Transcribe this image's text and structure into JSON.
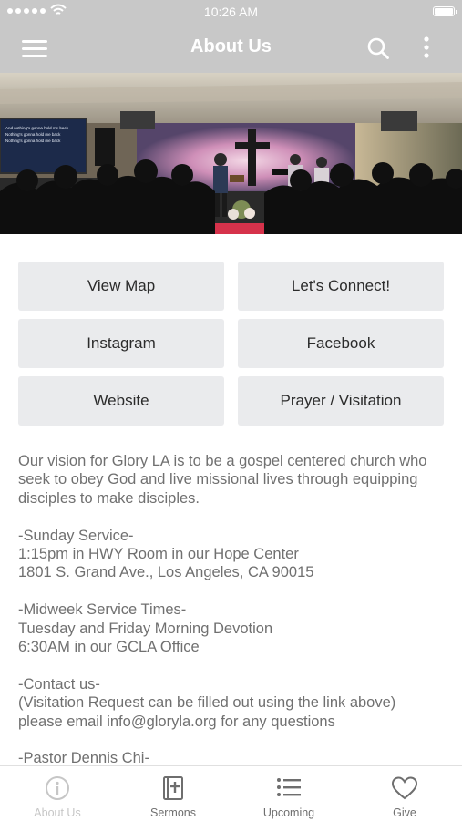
{
  "status_bar": {
    "time": "10:26 AM"
  },
  "nav_bar": {
    "title": "About Us"
  },
  "hero": {
    "screen_lines": [
      "And nothing's gonna hold me back",
      "Nothing's gonna hold me back",
      "Nothing's gonna hold me back"
    ]
  },
  "buttons": [
    {
      "label": "View Map"
    },
    {
      "label": "Let's Connect!"
    },
    {
      "label": "Instagram"
    },
    {
      "label": "Facebook"
    },
    {
      "label": "Website"
    },
    {
      "label": "Prayer / Visitation"
    }
  ],
  "content": {
    "vision": "Our vision for Glory LA is to be a gospel centered church who seek to obey God and live missional lives through equipping disciples to make disciples.",
    "sunday_heading": "-Sunday Service-",
    "sunday_time": "1:15pm in HWY Room in our Hope Center",
    "sunday_address": "1801 S. Grand Ave., Los Angeles, CA 90015",
    "midweek_heading": "-Midweek Service Times-",
    "midweek_days": "Tuesday and Friday Morning Devotion",
    "midweek_time": "6:30AM in our GCLA Office",
    "contact_heading": "-Contact us-",
    "contact_note": "(Visitation Request can be filled out using the link above)",
    "contact_email": "please email info@gloryla.org for any questions",
    "pastor_heading": "-Pastor Dennis Chi-"
  },
  "tabs": [
    {
      "label": "About Us",
      "icon": "info-icon",
      "active": true
    },
    {
      "label": "Sermons",
      "icon": "bible-icon",
      "active": false
    },
    {
      "label": "Upcoming",
      "icon": "list-icon",
      "active": false
    },
    {
      "label": "Give",
      "icon": "heart-icon",
      "active": false
    }
  ],
  "colors": {
    "bar_background": "#c8c8c8",
    "button_background": "#eaebed",
    "body_text": "#707070",
    "tab_active": "#c6c6c6",
    "tab_inactive": "#6e6e6e"
  }
}
